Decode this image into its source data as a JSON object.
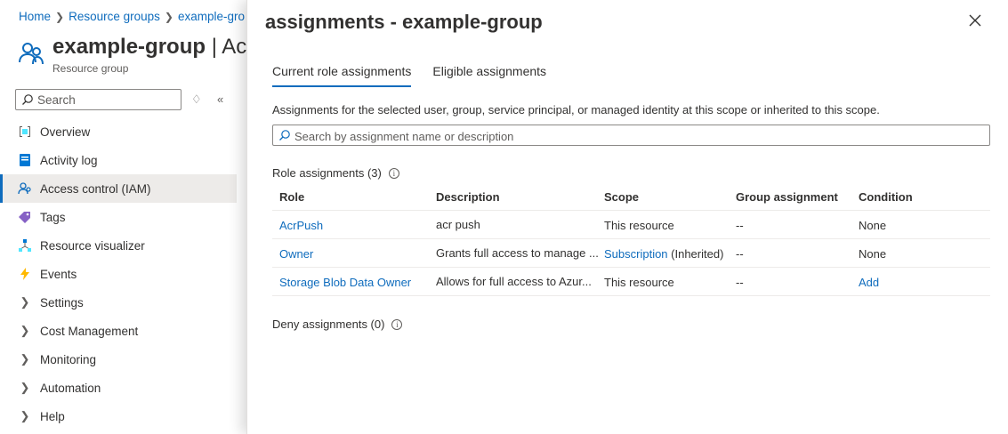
{
  "breadcrumb": {
    "home": "Home",
    "resource_groups": "Resource groups",
    "current": "example-gro"
  },
  "resource": {
    "title": "example-group",
    "title_suffix": " | Acc",
    "subtitle": "Resource group"
  },
  "left_search": {
    "placeholder": "Search"
  },
  "nav": {
    "overview": "Overview",
    "activity_log": "Activity log",
    "access_control": "Access control (IAM)",
    "tags": "Tags",
    "resource_visualizer": "Resource visualizer",
    "events": "Events",
    "settings": "Settings",
    "cost_management": "Cost Management",
    "monitoring": "Monitoring",
    "automation": "Automation",
    "help": "Help"
  },
  "panel": {
    "title": "assignments - example-group",
    "tabs": {
      "current": "Current role assignments",
      "eligible": "Eligible assignments"
    },
    "description": "Assignments for the selected user, group, service principal, or managed identity at this scope or inherited to this scope.",
    "search_placeholder": "Search by assignment name or description",
    "role_assignments_label": "Role assignments (3)",
    "deny_assignments_label": "Deny assignments (0)",
    "columns": {
      "role": "Role",
      "description": "Description",
      "scope": "Scope",
      "group": "Group assignment",
      "condition": "Condition"
    },
    "rows": [
      {
        "role": "AcrPush",
        "description": "acr push",
        "scope": "This resource",
        "scope_extra": "",
        "group": "--",
        "condition": "None"
      },
      {
        "role": "Owner",
        "description": "Grants full access to manage ...",
        "scope": "Subscription",
        "scope_extra": " (Inherited)",
        "group": "--",
        "condition": "None"
      },
      {
        "role": "Storage Blob Data Owner",
        "description": "Allows for full access to Azur...",
        "scope": "This resource",
        "scope_extra": "",
        "group": "--",
        "condition": "Add"
      }
    ]
  },
  "colors": {
    "accent": "#0f6cbd",
    "text": "#323130",
    "muted": "#605e5c"
  }
}
